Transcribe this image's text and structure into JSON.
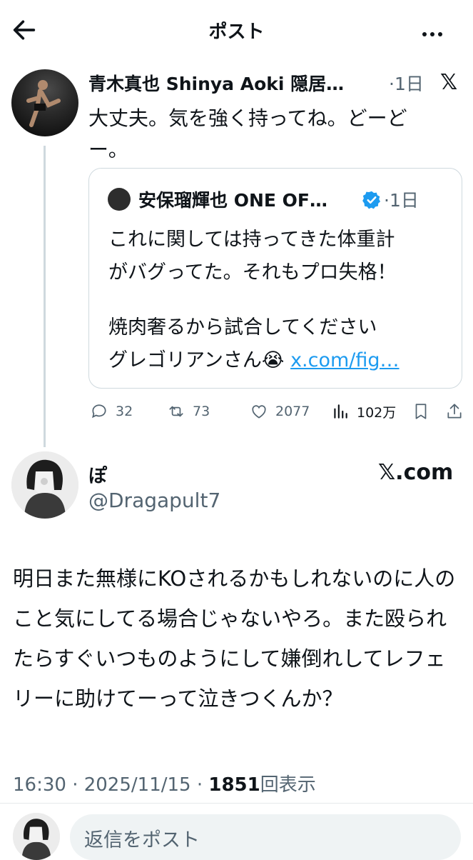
{
  "header": {
    "title": "ポスト",
    "back_icon": "arrow-left-icon",
    "more_icon": "more-horizontal-icon"
  },
  "parent_post": {
    "author": "青木真也 Shinya Aoki 隠居…",
    "time": "·1日",
    "text": "大丈夫。気を強く持ってね。どーどー。",
    "quote": {
      "author": "安保瑠輝也 ONE OF…",
      "time": "·1日",
      "lines": [
        "これに関しては持ってきた体重計",
        "がバグってた。それもプロ失格！",
        "",
        "焼肉奢るから試合してください"
      ],
      "last_line_text": "グレゴリアンさん😭 ",
      "link": "x.com/fig…"
    },
    "actions": {
      "replies": "32",
      "reposts": "73",
      "likes": "2077",
      "views": "102万"
    }
  },
  "reply_post": {
    "name": "ぽ",
    "handle": "@Dragapult7",
    "source": "𝕏.com",
    "text": "明日また無様にKOされるかもしれないのに人のこと気にしてる場合じゃないやろ。また殴られたらすぐいつものようにして嫌倒れしてレフェリーに助けてーって泣きつくんか？",
    "time": "16:30 · 2025/11/15 · ",
    "views_count": "1851",
    "views_label": "回表示"
  },
  "compose": {
    "placeholder": "返信をポスト"
  },
  "colors": {
    "accent": "#1d9bf0",
    "muted": "#536471",
    "text": "#0f1419"
  }
}
